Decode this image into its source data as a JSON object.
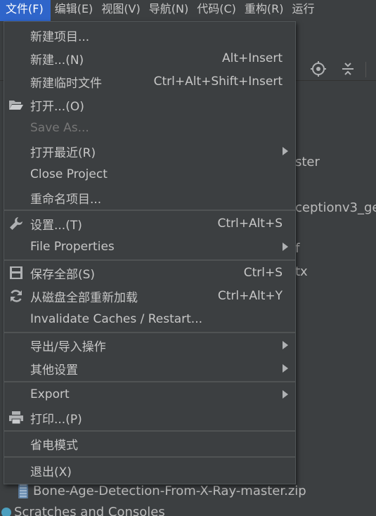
{
  "menubar": {
    "items": [
      {
        "label": "文件(F)",
        "active": true
      },
      {
        "label": "编辑(E)"
      },
      {
        "label": "视图(V)"
      },
      {
        "label": "导航(N)"
      },
      {
        "label": "代码(C)"
      },
      {
        "label": "重构(R)"
      },
      {
        "label": "运行"
      }
    ]
  },
  "background": {
    "tree_fragments": [
      "ster",
      "ceptionv3_ge",
      "f",
      "tx"
    ],
    "zip_file": "Bone-Age-Detection-From-X-Ray-master.zip",
    "scratches": "Scratches and Consoles"
  },
  "file_menu": {
    "new_project": "新建项目...",
    "new": "新建...(N)",
    "new_shortcut": "Alt+Insert",
    "new_scratch": "新建临时文件",
    "new_scratch_shortcut": "Ctrl+Alt+Shift+Insert",
    "open": "打开...(O)",
    "save_as": "Save As...",
    "open_recent": "打开最近(R)",
    "close_project": "Close Project",
    "rename_project": "重命名项目...",
    "settings": "设置...(T)",
    "settings_shortcut": "Ctrl+Alt+S",
    "file_properties": "File Properties",
    "save_all": "保存全部(S)",
    "save_all_shortcut": "Ctrl+S",
    "reload_all": "从磁盘全部重新加载",
    "reload_all_shortcut": "Ctrl+Alt+Y",
    "invalidate_caches": "Invalidate Caches / Restart...",
    "import_export": "导出/导入操作",
    "other_settings": "其他设置",
    "export": "Export",
    "print": "打印...(P)",
    "power_save": "省电模式",
    "exit": "退出(X)"
  },
  "colors": {
    "menu_bg": "#3c3f41",
    "active_menu": "#2f65ca",
    "text": "#c7c7c7",
    "disabled_text": "#767676"
  }
}
